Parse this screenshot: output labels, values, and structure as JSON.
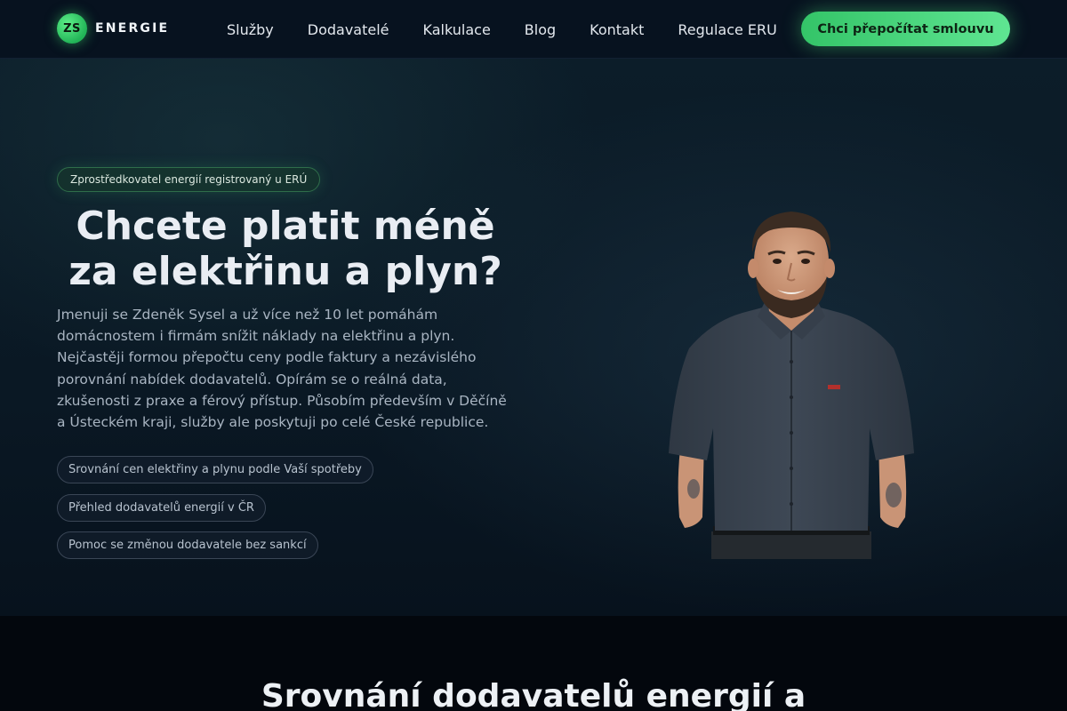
{
  "nav": {
    "logo_badge": "ZS",
    "logo_text": "ENERGIE",
    "links": [
      "Služby",
      "Dodavatelé",
      "Kalkulace",
      "Blog",
      "Kontakt",
      "Regulace ERU"
    ],
    "cta_label": "Chci přepočítat smlouvu"
  },
  "hero": {
    "pill": "Zprostředkovatel energií registrovaný u ERÚ",
    "title_line1": "Chcete platit méně",
    "title_line2": "za elektřinu a plyn?",
    "text": "Jmenuji se Zdeněk Sysel a už více než 10 let pomáhám domácnostem i firmám snížit náklady na elektřinu a plyn. Nejčastěji formou přepočtu ceny podle faktury a nezávislého porovnání nabídek dodavatelů. Opírám se o reálná data, zkušenosti z praxe a férový přístup. Působím především v Děčíně a Ústeckém kraji, služby ale poskytuji po celé České republice.",
    "features": [
      "Srovnání cen elektřiny a plynu podle Vaší spotřeby",
      "Přehled dodavatelů energií v ČR",
      "Pomoc se změnou dodavatele bez sankcí"
    ]
  },
  "section2": {
    "title": "Srovnání dodavatelů energií a"
  },
  "colors": {
    "accent": "#3fd474",
    "background": "#06101c",
    "shirt": "#3a4450"
  }
}
